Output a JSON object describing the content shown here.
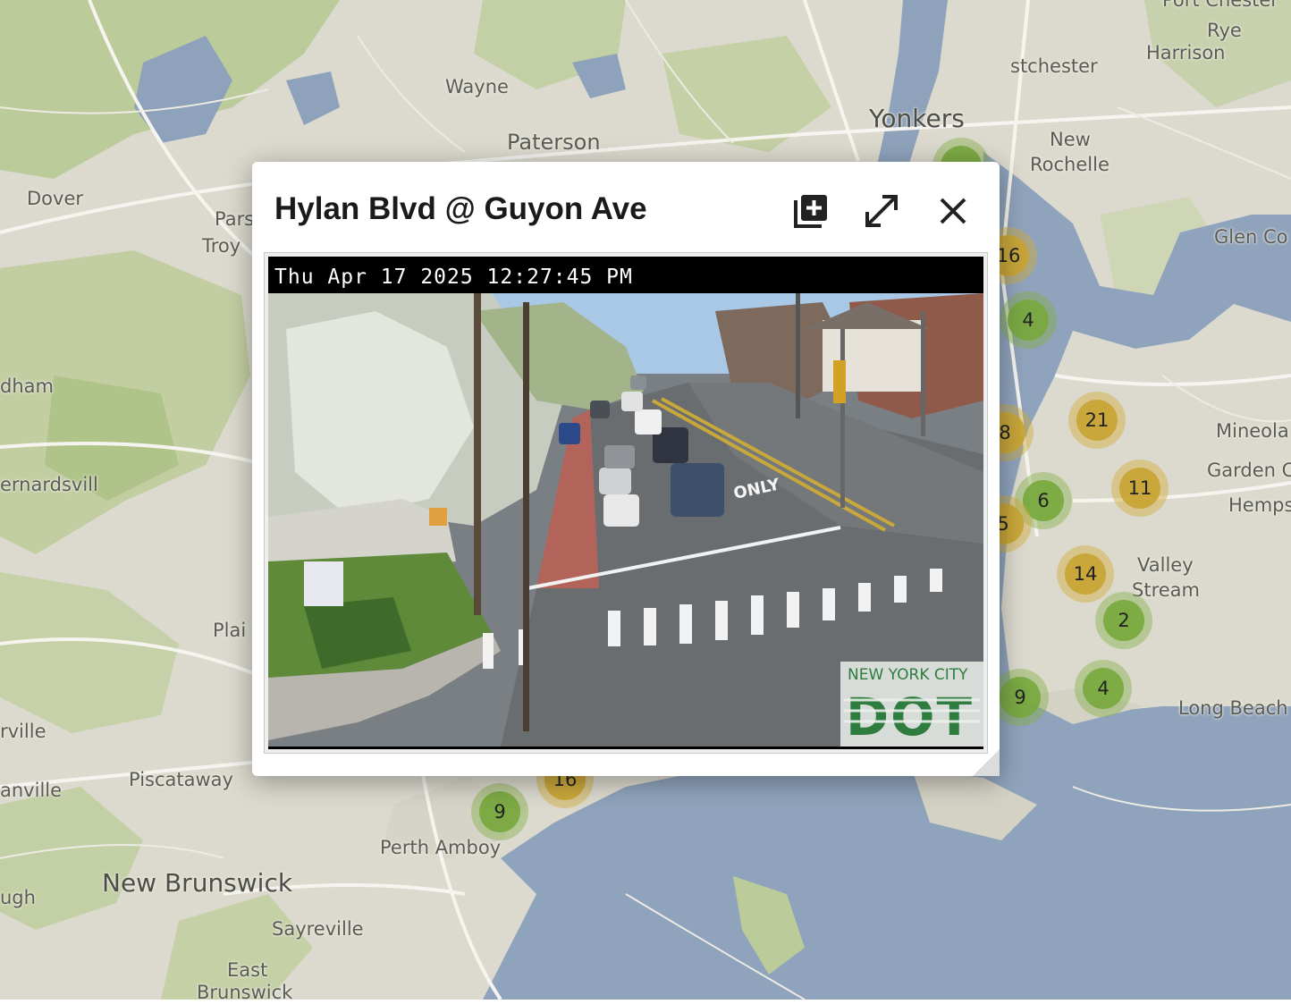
{
  "map": {
    "places": [
      {
        "key": "wayne",
        "label": "Wayne"
      },
      {
        "key": "paterson",
        "label": "Paterson"
      },
      {
        "key": "yonkers",
        "label": "Yonkers"
      },
      {
        "key": "dover",
        "label": "Dover"
      },
      {
        "key": "parsippany",
        "label": "Parsip"
      },
      {
        "key": "troy",
        "label": "Troy"
      },
      {
        "key": "westchester",
        "label": "stchester"
      },
      {
        "key": "harrison",
        "label": "Harrison"
      },
      {
        "key": "new",
        "label": "New"
      },
      {
        "key": "rochelle",
        "label": "Rochelle"
      },
      {
        "key": "glencove",
        "label": "Glen Co"
      },
      {
        "key": "mineola",
        "label": "Mineola"
      },
      {
        "key": "gardencity",
        "label": "Garden C"
      },
      {
        "key": "hemps",
        "label": "Hemps"
      },
      {
        "key": "valley",
        "label": "Valley"
      },
      {
        "key": "stream",
        "label": "Stream"
      },
      {
        "key": "longbeach",
        "label": "Long Beach"
      },
      {
        "key": "dham",
        "label": "dham"
      },
      {
        "key": "bernardsville",
        "label": "ernardsvill"
      },
      {
        "key": "plain",
        "label": "Plai"
      },
      {
        "key": "rville",
        "label": "rville"
      },
      {
        "key": "danville",
        "label": "anville"
      },
      {
        "key": "piscataway",
        "label": "Piscataway"
      },
      {
        "key": "perthamboy",
        "label": "Perth Amboy"
      },
      {
        "key": "newbrunswick",
        "label": "New Brunswick"
      },
      {
        "key": "ugh",
        "label": "ugh"
      },
      {
        "key": "sayreville",
        "label": "Sayreville"
      },
      {
        "key": "east",
        "label": "East"
      },
      {
        "key": "brunswick",
        "label": "Brunswick"
      },
      {
        "key": "portchester",
        "label": "Port Chester"
      },
      {
        "key": "rye",
        "label": "Rye"
      }
    ],
    "clusters": [
      {
        "count": "16",
        "color": "yellow"
      },
      {
        "count": "4",
        "color": "green"
      },
      {
        "count": "21",
        "color": "yellow"
      },
      {
        "count": "8",
        "color": "yellow"
      },
      {
        "count": "6",
        "color": "green"
      },
      {
        "count": "11",
        "color": "yellow"
      },
      {
        "count": "5",
        "color": "yellow"
      },
      {
        "count": "14",
        "color": "yellow"
      },
      {
        "count": "2",
        "color": "green"
      },
      {
        "count": "9",
        "color": "green"
      },
      {
        "count": "4",
        "color": "green"
      },
      {
        "count": "16",
        "color": "yellow"
      },
      {
        "count": "9",
        "color": "green"
      }
    ],
    "colors": {
      "land": "#dedcd0",
      "water": "#8fa3bc",
      "park": "#b8c996",
      "road": "#f4f3ee"
    }
  },
  "popup": {
    "title": "Hylan Blvd @ Guyon Ave",
    "buttons": {
      "add": "add-to-collection",
      "fullscreen": "expand",
      "close": "close"
    },
    "camera": {
      "timestamp": "Thu Apr 17 2025 12:27:45 PM",
      "logo_line1": "NEW YORK CITY",
      "logo_line2": "DOT",
      "road_marking": "ONLY"
    }
  }
}
